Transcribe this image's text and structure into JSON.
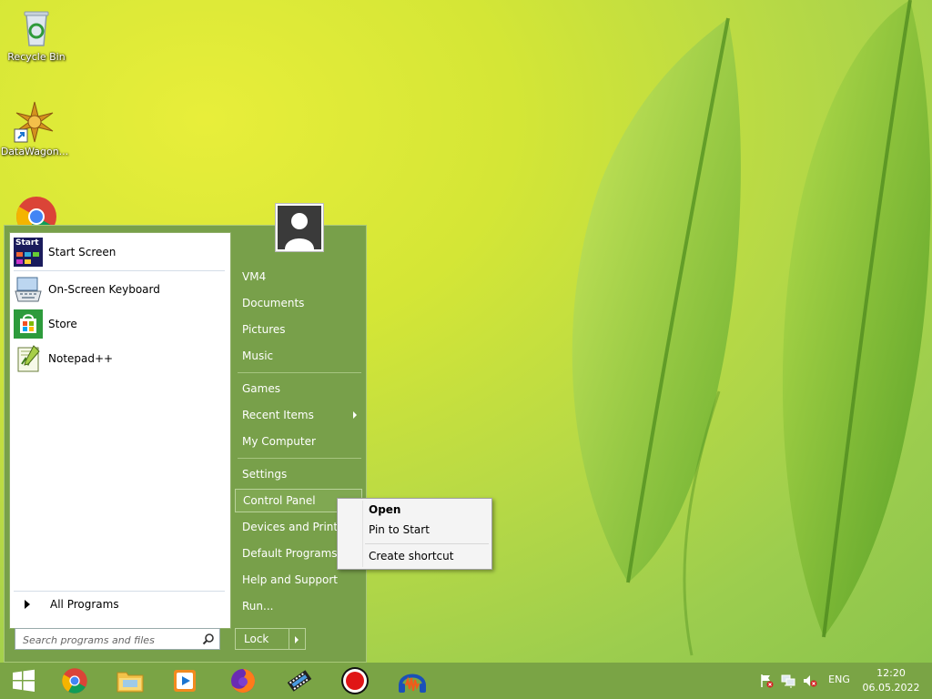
{
  "desktop": {
    "icons": [
      {
        "label": "Recycle Bin",
        "icon": "recycle-bin-icon"
      },
      {
        "label": "DataWagon...",
        "icon": "datawagon-icon"
      },
      {
        "label": "",
        "icon": "chrome-icon"
      }
    ]
  },
  "start_menu": {
    "pinned": [
      {
        "label": "Start Screen",
        "icon": "start-screen-icon",
        "badge": "Start"
      },
      {
        "label": "On-Screen Keyboard",
        "icon": "keyboard-icon"
      },
      {
        "label": "Store",
        "icon": "store-icon"
      },
      {
        "label": "Notepad++",
        "icon": "notepad-plus-plus-icon"
      }
    ],
    "all_programs": "All Programs",
    "search_placeholder": "Search programs and files",
    "right_items": [
      "VM4",
      "Documents",
      "Pictures",
      "Music",
      "Games",
      "Recent Items",
      "My Computer",
      "Settings",
      "Control Panel",
      "Devices and Printers",
      "Default Programs",
      "Help and Support",
      "Run..."
    ],
    "lock_label": "Lock"
  },
  "context_menu": {
    "items": [
      "Open",
      "Pin to Start",
      "Create shortcut"
    ]
  },
  "taskbar": {
    "apps": [
      "start-button",
      "chrome",
      "file-explorer",
      "media-player",
      "firefox",
      "movie-maker",
      "screen-recorder",
      "audacity"
    ],
    "language": "ENG",
    "time": "12:20",
    "date": "06.05.2022"
  },
  "colors": {
    "menu_green": "#78a04a",
    "taskbar_green": "#7aa445",
    "accent_blue": "#1b75d1"
  }
}
